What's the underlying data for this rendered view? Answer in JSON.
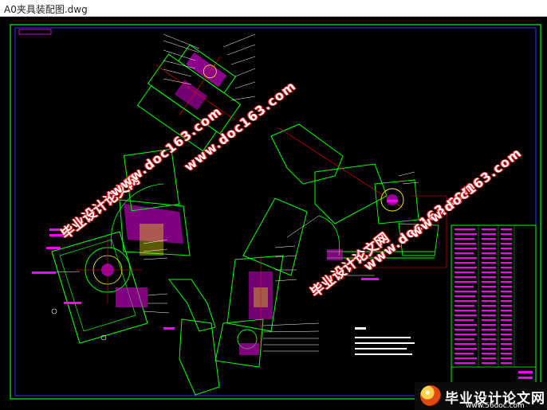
{
  "window": {
    "title": "A0夹具装配图.dwg"
  },
  "watermark": {
    "site_cn": "毕业设计论文网",
    "site_url": "www.doc163.com"
  },
  "footer": {
    "logo_text": "毕业设计论文网",
    "logo_url": "www.56doc.com"
  },
  "colors": {
    "background": "#000000",
    "frame": "#00ff00",
    "part_fill": "#ff00ff",
    "centerline": "#ff0000",
    "outline": "#00ff00",
    "text": "#ffffff",
    "title_block_text": "#ff00ff"
  }
}
